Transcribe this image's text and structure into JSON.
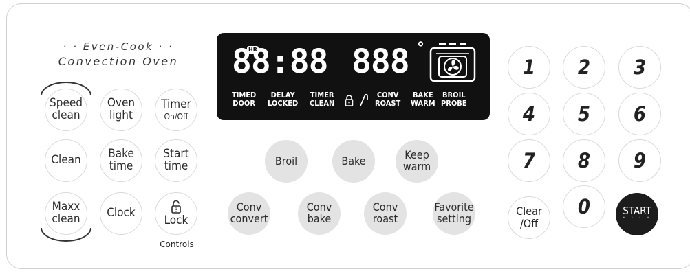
{
  "brand": {
    "line1": "· · Even-Cook · ·",
    "line2": "Convection Oven"
  },
  "left_buttons": {
    "speed_clean": [
      "Speed",
      "clean"
    ],
    "oven_light": [
      "Oven",
      "light"
    ],
    "timer": [
      "Timer",
      "On/Off"
    ],
    "clean": "Clean",
    "bake_time": [
      "Bake",
      "time"
    ],
    "start_time": [
      "Start",
      "time"
    ],
    "maxx_clean": [
      "Maxx",
      "clean"
    ],
    "clock": "Clock",
    "lock_label": "Lock",
    "lock_icon_digit": "3",
    "controls_label": "Controls"
  },
  "display": {
    "time": "88:88",
    "hr_badge": "HR",
    "temp": "888",
    "degree": "°",
    "indicators": {
      "timed_door": [
        "TIMED",
        "DOOR"
      ],
      "delay_locked": [
        "DELAY",
        "LOCKED"
      ],
      "timer_clean": [
        "TIMER",
        "CLEAN"
      ],
      "conv_roast": [
        "CONV",
        "ROAST"
      ],
      "bake_warm": [
        "BAKE",
        "WARM"
      ],
      "broil_probe": [
        "BROIL",
        "PROBE"
      ]
    }
  },
  "center_buttons": {
    "broil": "Broil",
    "bake": "Bake",
    "keep_warm": [
      "Keep",
      "warm"
    ],
    "conv_convert": [
      "Conv",
      "convert"
    ],
    "conv_bake": [
      "Conv",
      "bake"
    ],
    "conv_roast": [
      "Conv",
      "roast"
    ],
    "favorite_setting": [
      "Favorite",
      "setting"
    ]
  },
  "keypad": {
    "digits": [
      "1",
      "2",
      "3",
      "4",
      "5",
      "6",
      "7",
      "8",
      "9",
      "0"
    ],
    "clear": [
      "Clear",
      "/Off"
    ],
    "start": "START",
    "start_dots": "· · · ·"
  }
}
